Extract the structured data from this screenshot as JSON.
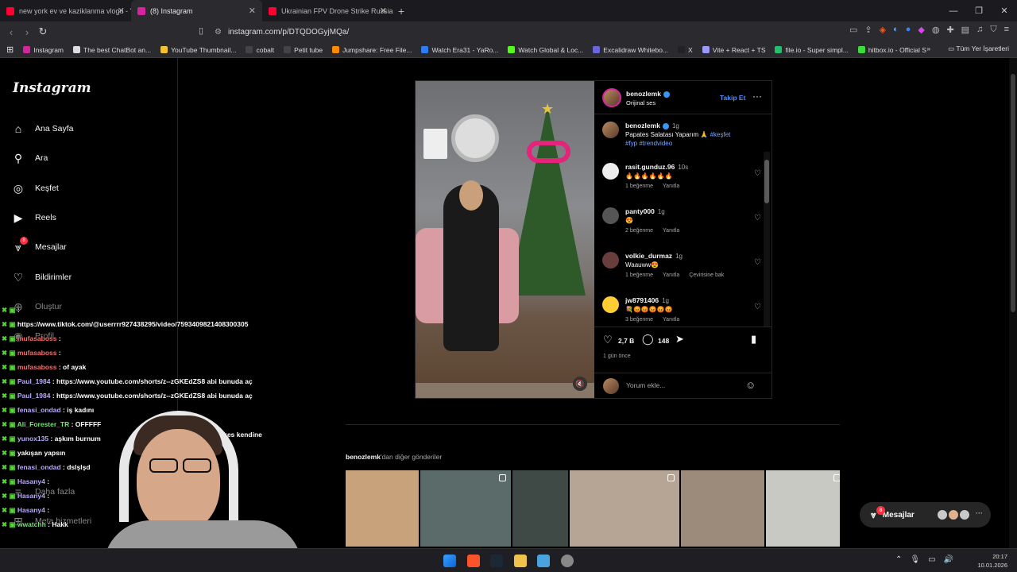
{
  "browser": {
    "tabs": [
      {
        "label": "new york ev ve kaziklanma vlogu - Yo",
        "icon_color": "#ff0033",
        "active": false
      },
      {
        "label": "(8) Instagram",
        "icon_color": "#d6249f",
        "active": true
      },
      {
        "label": "Ukrainian FPV Drone Strike Russian S",
        "icon_color": "#ff0033",
        "active": false
      }
    ],
    "url": "instagram.com/p/DTQDOGyjMQa/",
    "bookmarks": [
      {
        "label": "Instagram",
        "color": "#d6249f"
      },
      {
        "label": "The best ChatBot an...",
        "color": "#dddddd"
      },
      {
        "label": "YouTube Thumbnail...",
        "color": "#f2c230"
      },
      {
        "label": "cobalt",
        "color": "#444444"
      },
      {
        "label": "Petit tube",
        "color": "#444444"
      },
      {
        "label": "Jumpshare: Free File...",
        "color": "#ff8a00"
      },
      {
        "label": "Watch Era31 - YaRo...",
        "color": "#2e7cf6"
      },
      {
        "label": "Watch Global & Loc...",
        "color": "#53fc18"
      },
      {
        "label": "Excalidraw Whitebo...",
        "color": "#6965db"
      },
      {
        "label": "X",
        "color": "#222222"
      },
      {
        "label": "Vite + React + TS",
        "color": "#9999ff"
      },
      {
        "label": "file.io - Super simpl...",
        "color": "#21c16b"
      },
      {
        "label": "hitbox.io - Official Si...",
        "color": "#3cdc3c"
      }
    ],
    "bookmarks_folder": "Tüm Yer İşaretleri",
    "extension_badge": "11"
  },
  "sidebar": {
    "logo": "Instagram",
    "items": [
      {
        "label": "Ana Sayfa",
        "icon": "home-icon"
      },
      {
        "label": "Ara",
        "icon": "search-icon"
      },
      {
        "label": "Keşfet",
        "icon": "compass-icon"
      },
      {
        "label": "Reels",
        "icon": "reels-icon"
      },
      {
        "label": "Mesajlar",
        "icon": "messenger-icon",
        "badge": "8"
      },
      {
        "label": "Bildirimler",
        "icon": "heart-icon"
      },
      {
        "label": "Oluştur",
        "icon": "plus-icon"
      },
      {
        "label": "Profil",
        "icon": "avatar-icon"
      },
      {
        "label": "Daha fazla",
        "icon": "menu-icon"
      },
      {
        "label": "Meta hizmetleri",
        "icon": "grid-icon"
      }
    ]
  },
  "chat": [
    {
      "user": "",
      "user_color": "#8fd4ff",
      "text": ": "
    },
    {
      "user": "",
      "user_color": "#8fd4ff",
      "text": "https://www.tiktok.com/@userrrr927438295/video/7593409821408300305"
    },
    {
      "user": "mufasaboss",
      "user_color": "#ff6b6b",
      "text": " : "
    },
    {
      "user": "mufasaboss",
      "user_color": "#ff6b6b",
      "text": " : "
    },
    {
      "user": "mufasaboss",
      "user_color": "#ff6b6b",
      "text": " : of ayak"
    },
    {
      "user": "Paul_1984",
      "user_color": "#bba7ff",
      "text": " : https://www.youtube.com/shorts/z--zGKEdZS8 abi bunuda aç"
    },
    {
      "user": "Paul_1984",
      "user_color": "#bba7ff",
      "text": " : https://www.youtube.com/shorts/z--zGKEdZS8 abi bunuda aç"
    },
    {
      "user": "fenasi_ondad",
      "user_color": "#bba7ff",
      "text": " : iş kadını"
    },
    {
      "user": "Ali_Forester_TR",
      "user_color": "#7be07b",
      "text": " : OFFFFF"
    },
    {
      "user": "yunox135",
      "user_color": "#bba7ff",
      "text": " : aşkım burnum"
    },
    {
      "user": "",
      "user_color": "#ffffff",
      "text": "yakışan yapsın"
    },
    {
      "user": "fenasi_ondad",
      "user_color": "#bba7ff",
      "text": " : dslşlşd"
    },
    {
      "user": "Hasany4",
      "user_color": "#bba7ff",
      "text": " : "
    },
    {
      "user": "Hasany4",
      "user_color": "#bba7ff",
      "text": " : "
    },
    {
      "user": "Hasany4",
      "user_color": "#bba7ff",
      "text": " : "
    },
    {
      "user": "wwatchh",
      "user_color": "#7be07b",
      "text": " : Hakk"
    }
  ],
  "chat_fragment": "herkes kendine",
  "post": {
    "author": "benozlemk",
    "audio": "Orijinal ses",
    "follow_label": "Takip Et",
    "caption_time": "1g",
    "caption": "Papates Salatası Yaparım 🙏 ",
    "caption_tags": [
      "#keşfet",
      "#fyp",
      "#trendvideo"
    ],
    "comments": [
      {
        "user": "rasit.gunduz.96",
        "time": "10s",
        "text": "🔥🔥🔥🔥🔥🔥",
        "likes": "1 beğenme",
        "reply": "Yanıtla",
        "avatar": "#eeeeee"
      },
      {
        "user": "panty000",
        "time": "1g",
        "text": "😍",
        "likes": "2 beğenme",
        "reply": "Yanıtla",
        "avatar": "#555555"
      },
      {
        "user": "volkie_durmaz",
        "time": "1g",
        "text": "Waauww😍",
        "likes": "1 beğenme",
        "reply": "Yanıtla",
        "extra": "Çevirisine bak",
        "avatar": "#6a3d3d"
      },
      {
        "user": "jw8791406",
        "time": "1g",
        "text": "💐😡😡😡😡😡",
        "likes": "3 beğenme",
        "reply": "Yanıtla",
        "avatar": "#ffcc33"
      }
    ],
    "likes": "2,7 B",
    "comments_count": "148",
    "posted": "1 gün önce",
    "comment_placeholder": "Yorum ekle..."
  },
  "more_posts": {
    "author": "benozlemk",
    "label_suffix": "'dan diğer gönderiler",
    "thumbs": [
      {
        "color": "#c7a27a",
        "multi": false
      },
      {
        "color": "#5a6b6a",
        "multi": true
      },
      {
        "color": "#3f4a47",
        "multi": false
      },
      {
        "color": "#b6a595",
        "multi": true
      },
      {
        "color": "#9c8a7b",
        "multi": false
      },
      {
        "color": "#c9c9c4",
        "multi": true
      }
    ]
  },
  "messages_pill": {
    "label": "Mesajlar",
    "badge": "8"
  },
  "taskbar": {
    "time": "20:17",
    "date": "10.01.2026"
  }
}
